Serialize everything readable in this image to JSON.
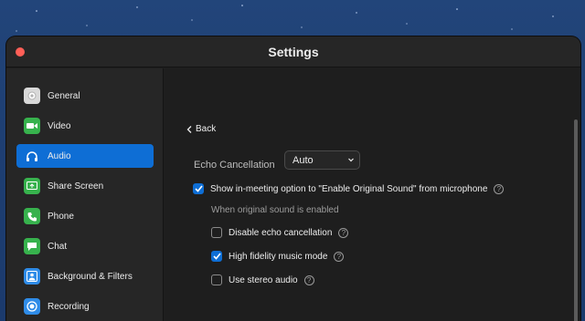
{
  "window": {
    "title": "Settings"
  },
  "sidebar": {
    "items": [
      {
        "label": "General",
        "icon": "gear-icon",
        "color": "#d9d9d9",
        "active": false
      },
      {
        "label": "Video",
        "icon": "video-camera-icon",
        "color": "#37b24d",
        "active": false
      },
      {
        "label": "Audio",
        "icon": "headphones-icon",
        "color": "#0e6ed5",
        "active": true
      },
      {
        "label": "Share Screen",
        "icon": "share-screen-icon",
        "color": "#37b24d",
        "active": false
      },
      {
        "label": "Phone",
        "icon": "phone-icon",
        "color": "#37b24d",
        "active": false
      },
      {
        "label": "Chat",
        "icon": "chat-bubble-icon",
        "color": "#37b24d",
        "active": false
      },
      {
        "label": "Background & Filters",
        "icon": "person-background-icon",
        "color": "#2f8ce8",
        "active": false
      },
      {
        "label": "Recording",
        "icon": "record-icon",
        "color": "#2f8ce8",
        "active": false
      }
    ]
  },
  "main": {
    "back_label": "Back",
    "echo_label": "Echo Cancellation",
    "echo_value": "Auto",
    "original_sound_label": "Show in-meeting option to \"Enable Original Sound\" from microphone",
    "original_sound_checked": true,
    "subtext": "When original sound is enabled",
    "options": [
      {
        "label": "Disable echo cancellation",
        "checked": false
      },
      {
        "label": "High fidelity music mode",
        "checked": true
      },
      {
        "label": "Use stereo audio",
        "checked": false
      }
    ]
  },
  "colors": {
    "accent": "#0e6ed5",
    "close": "#ff5f57"
  }
}
